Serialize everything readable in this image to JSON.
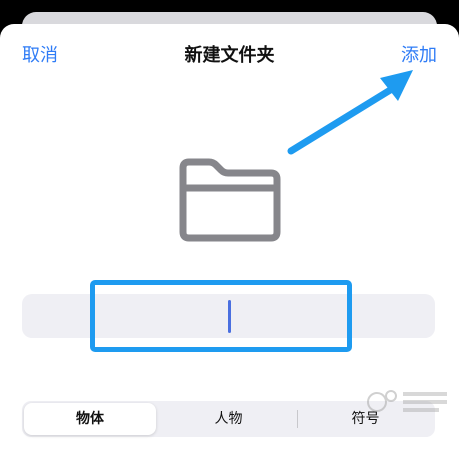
{
  "nav": {
    "cancel_label": "取消",
    "title": "新建文件夹",
    "add_label": "添加"
  },
  "folder_name_input": {
    "value": "",
    "placeholder": ""
  },
  "segments": [
    {
      "label": "物体",
      "selected": true
    },
    {
      "label": "人物",
      "selected": false
    },
    {
      "label": "符号",
      "selected": false
    }
  ],
  "icons": {
    "folder": "folder-icon",
    "annotation_arrow": "arrow-icon"
  },
  "colors": {
    "accent": "#2f7cf6",
    "highlight": "#1e9bf0",
    "folder": "#86868b"
  }
}
